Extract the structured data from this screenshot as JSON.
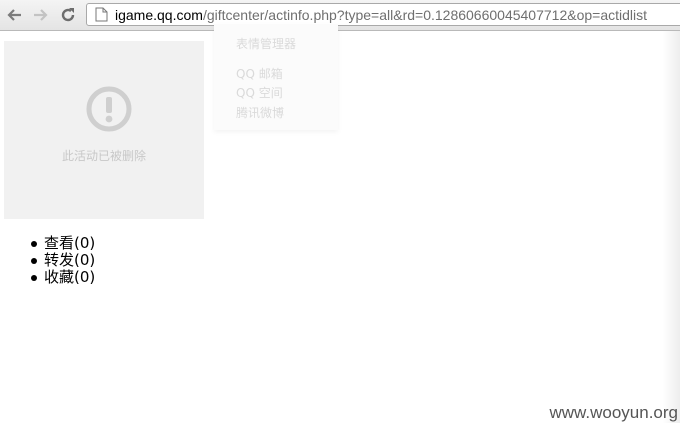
{
  "browser": {
    "url_domain": "igame.qq.com",
    "url_path": "/giftcenter/actinfo.php?type=all&rd=0.12860660045407712&op=actidlist"
  },
  "ghost_menu": {
    "items": [
      "",
      "",
      "表情管理器",
      "QQ 邮箱",
      "QQ 空间",
      "腾讯微博"
    ]
  },
  "activity": {
    "deleted_notice": "此活动已被删除"
  },
  "stats": [
    {
      "label": "查看",
      "count": "(0)"
    },
    {
      "label": "转发",
      "count": "(0)"
    },
    {
      "label": "收藏",
      "count": "(0)"
    }
  ],
  "watermark": "www.wooyun.org",
  "colors": {
    "placeholder_bg": "#f1f1f1",
    "placeholder_text": "#c8c8c8"
  }
}
